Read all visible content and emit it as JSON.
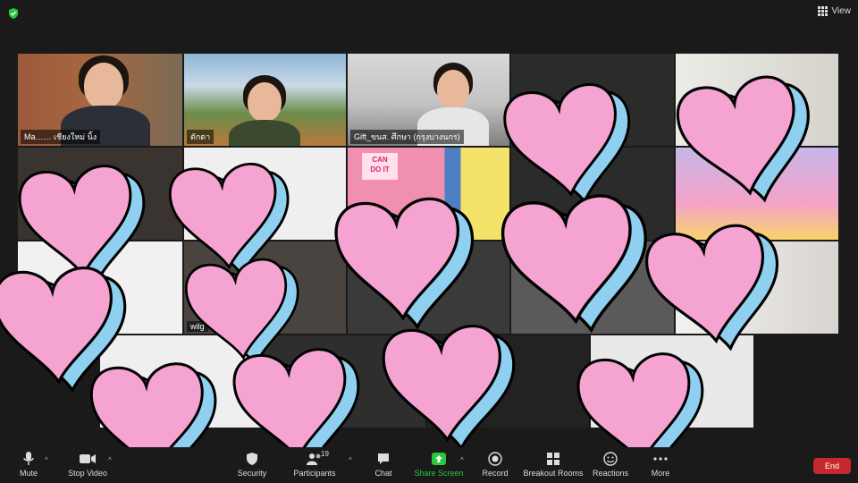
{
  "top_bar": {
    "view_label": "View"
  },
  "tiles": [
    {
      "name": "Ma…… เชียงใหม่ นิ้ง"
    },
    {
      "name": "ตักตา"
    },
    {
      "name": "Gift_ขนส. ศึกษา (กรุงบางนกร)"
    },
    {
      "name": ""
    },
    {
      "name": ""
    },
    {
      "name": ""
    },
    {
      "name": ""
    },
    {
      "name": ""
    },
    {
      "name": ""
    },
    {
      "name": ""
    },
    {
      "name": ""
    },
    {
      "name": ""
    },
    {
      "name": ""
    },
    {
      "name": ""
    },
    {
      "name": ""
    },
    {
      "name": ""
    },
    {
      "name": ""
    },
    {
      "name": ""
    },
    {
      "name": ""
    },
    {
      "name": "wilg"
    },
    {
      "name": ""
    },
    {
      "name": ""
    },
    {
      "name": ""
    },
    {
      "name": ""
    }
  ],
  "poster": {
    "line1": "CAN",
    "line2": "DO IT"
  },
  "toolbar": {
    "mute": "Mute",
    "stop_video": "Stop Video",
    "security": "Security",
    "participants": "Participants",
    "participants_count": "19",
    "chat": "Chat",
    "share_screen": "Share Screen",
    "record": "Record",
    "breakout_rooms": "Breakout Rooms",
    "reactions": "Reactions",
    "more": "More",
    "end": "End"
  },
  "colors": {
    "active_speaker": "#c8e65a",
    "share_green": "#28c840",
    "end_red": "#c5282f",
    "heart_pink": "#f5a3d0",
    "heart_shadow": "#8fd0f0"
  }
}
